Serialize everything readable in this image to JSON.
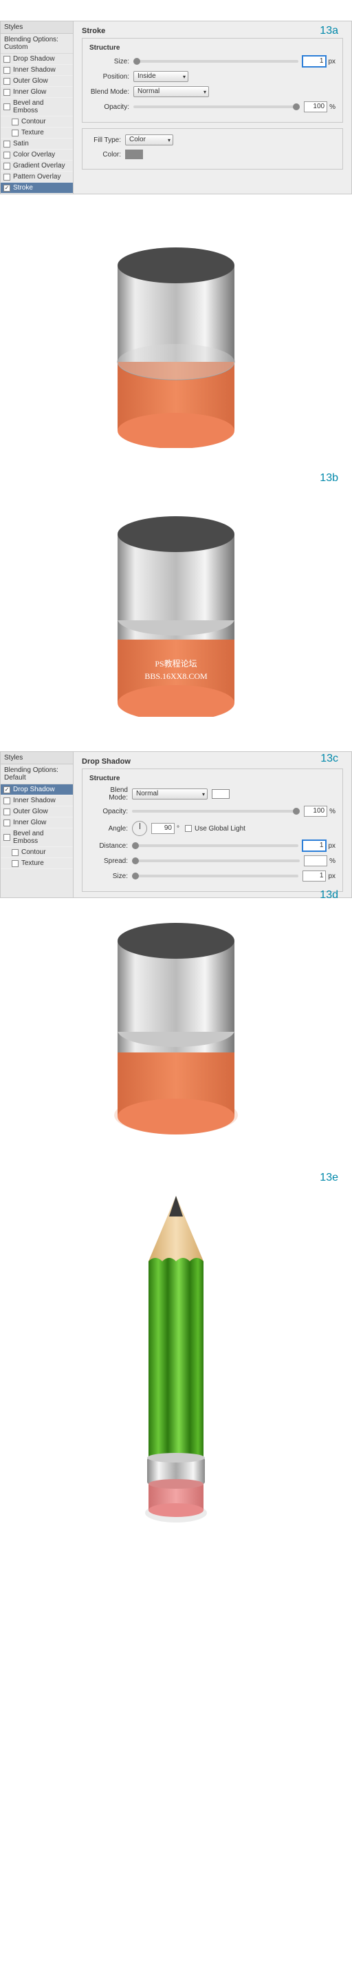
{
  "steps": {
    "a": "13a",
    "b": "13b",
    "c": "13c",
    "d": "13d",
    "e": "13e"
  },
  "styles_panel_a": {
    "header": "Styles",
    "blending": "Blending Options: Custom",
    "items": [
      {
        "label": "Drop Shadow",
        "checked": false,
        "indent": false
      },
      {
        "label": "Inner Shadow",
        "checked": false,
        "indent": false
      },
      {
        "label": "Outer Glow",
        "checked": false,
        "indent": false
      },
      {
        "label": "Inner Glow",
        "checked": false,
        "indent": false
      },
      {
        "label": "Bevel and Emboss",
        "checked": false,
        "indent": false
      },
      {
        "label": "Contour",
        "checked": false,
        "indent": true
      },
      {
        "label": "Texture",
        "checked": false,
        "indent": true
      },
      {
        "label": "Satin",
        "checked": false,
        "indent": false
      },
      {
        "label": "Color Overlay",
        "checked": false,
        "indent": false
      },
      {
        "label": "Gradient Overlay",
        "checked": false,
        "indent": false
      },
      {
        "label": "Pattern Overlay",
        "checked": false,
        "indent": false
      },
      {
        "label": "Stroke",
        "checked": true,
        "indent": false,
        "active": true
      }
    ]
  },
  "stroke_panel": {
    "title": "Stroke",
    "structure_label": "Structure",
    "size": {
      "label": "Size:",
      "value": "1",
      "unit": "px"
    },
    "position": {
      "label": "Position:",
      "value": "Inside"
    },
    "blend_mode": {
      "label": "Blend Mode:",
      "value": "Normal"
    },
    "opacity": {
      "label": "Opacity:",
      "value": "100",
      "unit": "%"
    },
    "fill_type": {
      "label": "Fill Type:",
      "value": "Color"
    },
    "color_label": "Color:"
  },
  "styles_panel_c": {
    "header": "Styles",
    "blending": "Blending Options: Default",
    "items": [
      {
        "label": "Drop Shadow",
        "checked": true,
        "indent": false,
        "active": true
      },
      {
        "label": "Inner Shadow",
        "checked": false,
        "indent": false
      },
      {
        "label": "Outer Glow",
        "checked": false,
        "indent": false
      },
      {
        "label": "Inner Glow",
        "checked": false,
        "indent": false
      },
      {
        "label": "Bevel and Emboss",
        "checked": false,
        "indent": false
      },
      {
        "label": "Contour",
        "checked": false,
        "indent": true
      },
      {
        "label": "Texture",
        "checked": false,
        "indent": true
      }
    ]
  },
  "ds_panel": {
    "title": "Drop Shadow",
    "structure_label": "Structure",
    "blend_mode": {
      "label": "Blend Mode:",
      "value": "Normal"
    },
    "opacity": {
      "label": "Opacity:",
      "value": "100",
      "unit": "%"
    },
    "angle": {
      "label": "Angle:",
      "value": "90",
      "unit": "°",
      "global": "Use Global Light"
    },
    "distance": {
      "label": "Distance:",
      "value": "1",
      "unit": "px"
    },
    "spread": {
      "label": "Spread:",
      "value": "",
      "unit": "%"
    },
    "size": {
      "label": "Size:",
      "value": "1",
      "unit": "px"
    }
  },
  "watermark": {
    "line1": "PS教程论坛",
    "line2": "BBS.16XX8.COM"
  },
  "colors": {
    "accent": "#0088aa",
    "cyl_orange": "#ee8258",
    "cyl_dark": "#4a4a4a",
    "cyl_silver1": "#e8e8e8",
    "cyl_silver2": "#a8a8a8",
    "pencil_green": "#5bb82a",
    "pencil_dark": "#2e7a10",
    "eraser": "#e88a8a"
  }
}
